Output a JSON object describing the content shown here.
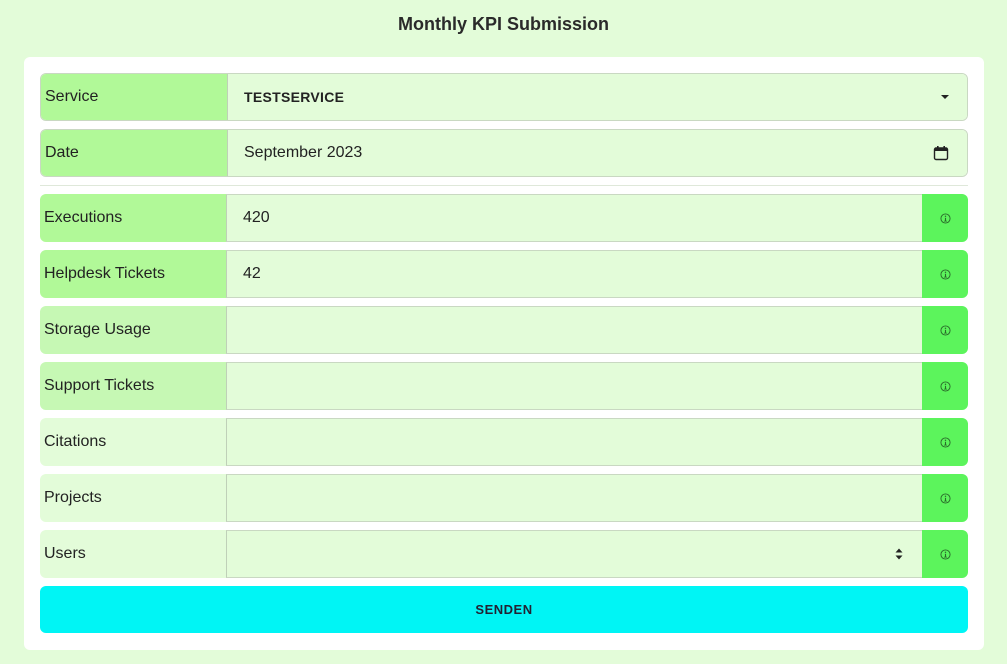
{
  "page": {
    "title": "Monthly KPI Submission"
  },
  "form": {
    "service": {
      "label": "Service",
      "value": "TESTSERVICE"
    },
    "date": {
      "label": "Date",
      "value": "September 2023"
    },
    "executions": {
      "label": "Executions",
      "value": "420"
    },
    "helpdesk_tickets": {
      "label": "Helpdesk Tickets",
      "value": "42"
    },
    "storage_usage": {
      "label": "Storage Usage",
      "value": ""
    },
    "support_tickets": {
      "label": "Support Tickets",
      "value": ""
    },
    "citations": {
      "label": "Citations",
      "value": ""
    },
    "projects": {
      "label": "Projects",
      "value": ""
    },
    "users": {
      "label": "Users",
      "value": ""
    },
    "submit_label": "SENDEN"
  },
  "icons": {
    "info": "info-icon",
    "select": "chevron-down-icon",
    "date": "calendar-icon",
    "number": "spinner-icon"
  },
  "colors": {
    "page_background": "#e3fcd9",
    "label_required_filled": "#b1f998",
    "label_required_empty": "#c6f8b4",
    "label_optional": "#e3fcd9",
    "info_button": "#5cf45c",
    "submit_button": "#00f5f5"
  }
}
